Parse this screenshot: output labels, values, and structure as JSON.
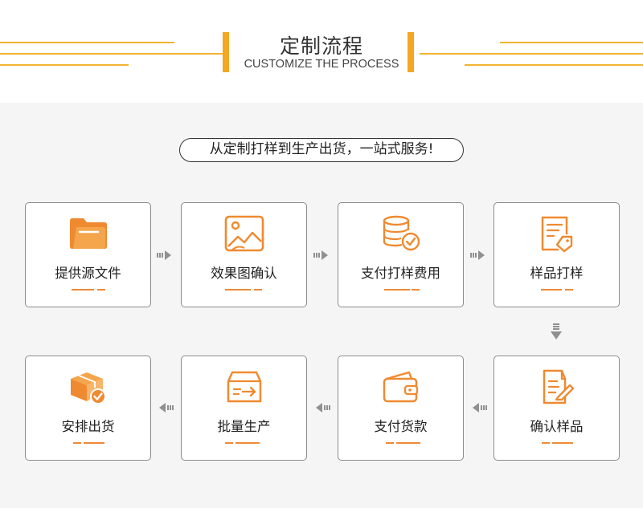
{
  "header": {
    "title": "定制流程",
    "subtitle": "CUSTOMIZE THE PROCESS"
  },
  "slogan": "从定制打样到生产出货，一站式服务!",
  "steps": [
    {
      "label": "提供源文件",
      "icon": "folder-icon"
    },
    {
      "label": "效果图确认",
      "icon": "image-icon"
    },
    {
      "label": "支付打样费用",
      "icon": "coins-check-icon"
    },
    {
      "label": "样品打样",
      "icon": "document-tag-icon"
    },
    {
      "label": "确认样品",
      "icon": "document-edit-icon"
    },
    {
      "label": "支付货款",
      "icon": "wallet-icon"
    },
    {
      "label": "批量生产",
      "icon": "box-arrow-icon"
    },
    {
      "label": "安排出货",
      "icon": "package-check-icon"
    }
  ],
  "colors": {
    "accent": "#f08a35",
    "line": "#f2b330",
    "background": "#f6f5f5",
    "arrow": "#909090"
  }
}
